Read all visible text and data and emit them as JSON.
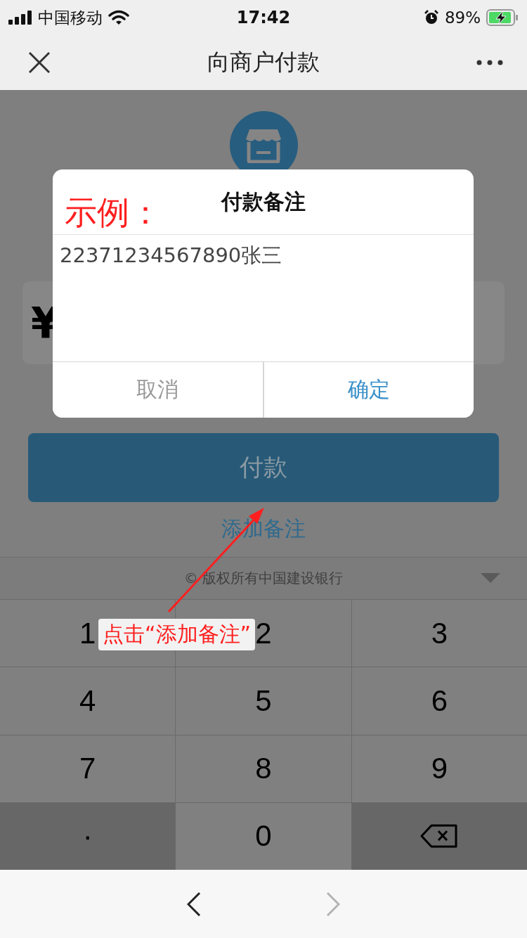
{
  "status_bar": {
    "carrier": "中国移动",
    "time": "17:42",
    "battery": "89%"
  },
  "nav_bar": {
    "title": "向商户付款"
  },
  "amount_field": {
    "currency": "¥"
  },
  "pay_button": {
    "label": "付款"
  },
  "add_note_link": {
    "label": "添加备注"
  },
  "keyboard": {
    "title": "© 版权所有中国建设银行",
    "keys": [
      {
        "kind": "digit",
        "label": "1"
      },
      {
        "kind": "digit",
        "label": "2"
      },
      {
        "kind": "digit",
        "label": "3"
      },
      {
        "kind": "digit",
        "label": "4"
      },
      {
        "kind": "digit",
        "label": "5"
      },
      {
        "kind": "digit",
        "label": "6"
      },
      {
        "kind": "digit",
        "label": "7"
      },
      {
        "kind": "digit",
        "label": "8"
      },
      {
        "kind": "digit",
        "label": "9"
      },
      {
        "kind": "dot",
        "label": "·"
      },
      {
        "kind": "digit",
        "label": "0"
      },
      {
        "kind": "backspace"
      }
    ]
  },
  "browser_toolbar": {
    "back": {
      "disabled": false
    },
    "forward": {
      "disabled": true
    }
  },
  "dialog": {
    "title": "付款备注",
    "value": "22371234567890张三",
    "buttons": [
      {
        "kind": "cancel",
        "label": "取消"
      },
      {
        "kind": "confirm",
        "label": "确定"
      }
    ]
  },
  "annotations": [
    {
      "kind": "label",
      "text": "示例："
    },
    {
      "kind": "callout",
      "text": "点击“添加备注”"
    }
  ]
}
